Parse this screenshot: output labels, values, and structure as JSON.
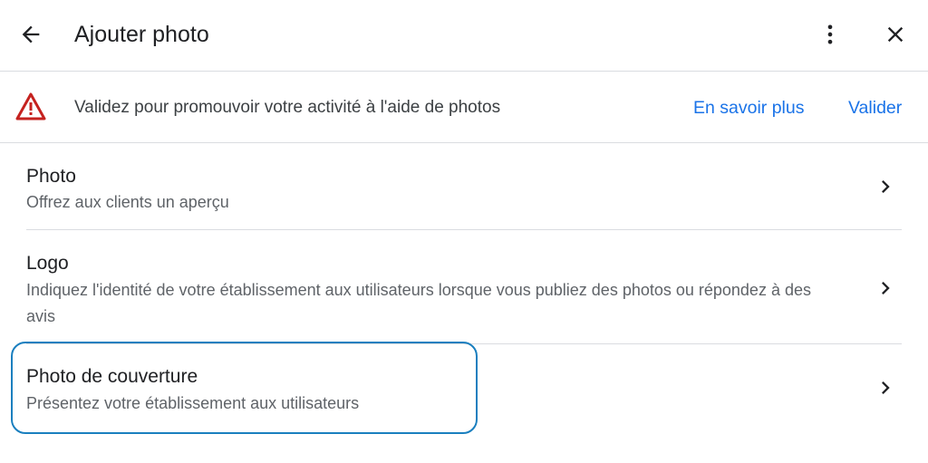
{
  "header": {
    "title": "Ajouter photo",
    "back_icon": "arrow-back-icon",
    "more_icon": "more-vert-icon",
    "close_icon": "close-icon"
  },
  "banner": {
    "icon": "warning-icon",
    "text": "Validez pour promouvoir votre activité à l'aide de photos",
    "learn_more": "En savoir plus",
    "validate": "Valider"
  },
  "items": [
    {
      "title": "Photo",
      "description": "Offrez aux clients un aperçu"
    },
    {
      "title": "Logo",
      "description": "Indiquez l'identité de votre établissement aux utilisateurs lorsque vous publiez des photos ou répondez à des avis"
    },
    {
      "title": "Photo de couverture",
      "description": "Présentez votre établissement aux utilisateurs"
    }
  ],
  "colors": {
    "link": "#1a73e8",
    "warning": "#c5221f",
    "highlight_border": "#1a7fbf",
    "divider": "#dadce0"
  }
}
